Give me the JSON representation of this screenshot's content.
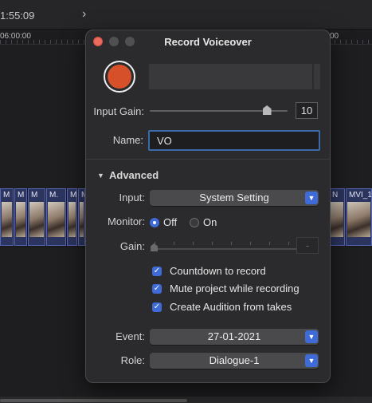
{
  "timeline": {
    "timecode": "1:55:09",
    "ruler_left": "06:00:00",
    "ruler_right": "00",
    "clips_left": [
      {
        "label": "M"
      },
      {
        "label": "M"
      },
      {
        "label": "M"
      },
      {
        "label": "M."
      },
      {
        "label": "M"
      },
      {
        "label": "M"
      }
    ],
    "clips_right": [
      {
        "label": "N"
      },
      {
        "label": "MVI_1"
      },
      {
        "label": ""
      }
    ]
  },
  "dialog": {
    "title": "Record Voiceover",
    "input_gain_label": "Input Gain:",
    "input_gain_value": "10",
    "input_gain_level": 0.85,
    "name_label": "Name:",
    "name_value": "VO",
    "advanced_label": "Advanced",
    "input_label": "Input:",
    "input_value": "System Setting",
    "monitor_label": "Monitor:",
    "monitor_off": "Off",
    "monitor_on": "On",
    "monitor_selected": "Off",
    "gain_label": "Gain:",
    "gain_value": "-",
    "checkboxes": [
      {
        "label": "Countdown to record",
        "checked": true
      },
      {
        "label": "Mute project while recording",
        "checked": true
      },
      {
        "label": "Create Audition from takes",
        "checked": true
      }
    ],
    "event_label": "Event:",
    "event_value": "27-01-2021",
    "role_label": "Role:",
    "role_value": "Dialogue-1"
  },
  "colors": {
    "record": "#d6512a",
    "accent": "#3e6bd8",
    "clip_border": "#5866b6",
    "close": "#ed6a5e"
  },
  "icons": {
    "chevron": "chevron-right-icon",
    "disclosure": "disclosure-triangle-down-icon",
    "popup": "popup-chevron-icon",
    "check": "checkmark-icon"
  }
}
